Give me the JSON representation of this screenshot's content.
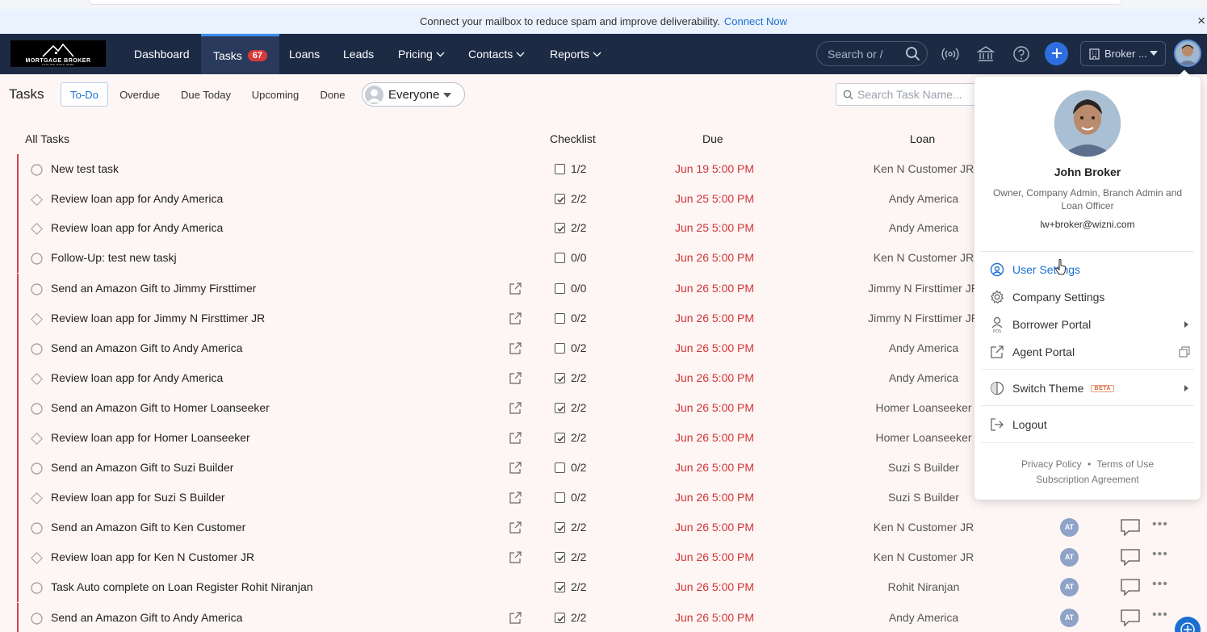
{
  "banner": {
    "message": "Connect your mailbox to reduce spam and improve deliverability.",
    "link": "Connect Now",
    "close": "×"
  },
  "logo": {
    "text": "MORTGAGE BROKER",
    "tagline": "TAGLINE GOES HERE"
  },
  "nav": {
    "items": [
      {
        "label": "Dashboard"
      },
      {
        "label": "Tasks",
        "badge": "67"
      },
      {
        "label": "Loans"
      },
      {
        "label": "Leads"
      },
      {
        "label": "Pricing"
      },
      {
        "label": "Contacts"
      },
      {
        "label": "Reports"
      }
    ],
    "search_placeholder": "Search or /",
    "broker_label": "Broker ..."
  },
  "toolbar": {
    "title": "Tasks",
    "tabs": [
      "To-Do",
      "Overdue",
      "Due Today",
      "Upcoming",
      "Done"
    ],
    "active_tab": "To-Do",
    "assignee": "Everyone",
    "search_placeholder": "Search Task Name..."
  },
  "columns": {
    "name": "All Tasks",
    "checklist": "Checklist",
    "due": "Due",
    "loan": "Loan"
  },
  "tasks": [
    {
      "name": "New test task",
      "shape": "circle",
      "ext": false,
      "checked": false,
      "count": "1/2",
      "due": "Jun 19 5:00 PM",
      "loan": "Ken N Customer JR",
      "assignee": ""
    },
    {
      "name": "Review loan app for Andy America",
      "shape": "diamond",
      "ext": false,
      "checked": true,
      "count": "2/2",
      "due": "Jun 25 5:00 PM",
      "loan": "Andy America",
      "assignee": ""
    },
    {
      "name": "Review loan app for Andy America",
      "shape": "diamond",
      "ext": false,
      "checked": true,
      "count": "2/2",
      "due": "Jun 25 5:00 PM",
      "loan": "Andy America",
      "assignee": ""
    },
    {
      "name": "Follow-Up: test new taskj",
      "shape": "circle",
      "ext": false,
      "checked": false,
      "count": "0/0",
      "due": "Jun 26 5:00 PM",
      "loan": "Ken N Customer JR",
      "assignee": ""
    },
    {
      "name": "Send an Amazon Gift to Jimmy Firsttimer",
      "shape": "circle",
      "ext": true,
      "checked": false,
      "count": "0/0",
      "due": "Jun 26 5:00 PM",
      "loan": "Jimmy N Firsttimer JR",
      "assignee": ""
    },
    {
      "name": "Review loan app for Jimmy N Firsttimer JR",
      "shape": "diamond",
      "ext": true,
      "checked": false,
      "count": "0/2",
      "due": "Jun 26 5:00 PM",
      "loan": "Jimmy N Firsttimer JR",
      "assignee": ""
    },
    {
      "name": "Send an Amazon Gift to Andy America",
      "shape": "circle",
      "ext": true,
      "checked": false,
      "count": "0/2",
      "due": "Jun 26 5:00 PM",
      "loan": "Andy America",
      "assignee": ""
    },
    {
      "name": "Review loan app for Andy America",
      "shape": "diamond",
      "ext": true,
      "checked": true,
      "count": "2/2",
      "due": "Jun 26 5:00 PM",
      "loan": "Andy America",
      "assignee": ""
    },
    {
      "name": "Send an Amazon Gift to Homer Loanseeker",
      "shape": "circle",
      "ext": true,
      "checked": true,
      "count": "2/2",
      "due": "Jun 26 5:00 PM",
      "loan": "Homer Loanseeker",
      "assignee": ""
    },
    {
      "name": "Review loan app for Homer Loanseeker",
      "shape": "diamond",
      "ext": true,
      "checked": true,
      "count": "2/2",
      "due": "Jun 26 5:00 PM",
      "loan": "Homer Loanseeker",
      "assignee": ""
    },
    {
      "name": "Send an Amazon Gift to Suzi Builder",
      "shape": "circle",
      "ext": true,
      "checked": false,
      "count": "0/2",
      "due": "Jun 26 5:00 PM",
      "loan": "Suzi S Builder",
      "assignee": ""
    },
    {
      "name": "Review loan app for Suzi S Builder",
      "shape": "diamond",
      "ext": true,
      "checked": false,
      "count": "0/2",
      "due": "Jun 26 5:00 PM",
      "loan": "Suzi S Builder",
      "assignee": ""
    },
    {
      "name": "Send an Amazon Gift to Ken Customer",
      "shape": "circle",
      "ext": true,
      "checked": true,
      "count": "2/2",
      "due": "Jun 26 5:00 PM",
      "loan": "Ken N Customer JR",
      "assignee": "AT"
    },
    {
      "name": "Review loan app for Ken N Customer JR",
      "shape": "diamond",
      "ext": true,
      "checked": true,
      "count": "2/2",
      "due": "Jun 26 5:00 PM",
      "loan": "Ken N Customer JR",
      "assignee": "AT"
    },
    {
      "name": "Task Auto complete on Loan Register Rohit Niranjan",
      "shape": "circle",
      "ext": false,
      "checked": true,
      "count": "2/2",
      "due": "Jun 26 5:00 PM",
      "loan": "Rohit Niranjan",
      "assignee": "AT"
    },
    {
      "name": "Send an Amazon Gift to Andy America",
      "shape": "circle",
      "ext": true,
      "checked": true,
      "count": "2/2",
      "due": "Jun 26 5:00 PM",
      "loan": "Andy America",
      "assignee": "AT"
    }
  ],
  "user_menu": {
    "name": "John Broker",
    "roles": "Owner, Company Admin, Branch Admin and Loan Officer",
    "email": "lw+broker@wizni.com",
    "items": [
      {
        "label": "User Settings",
        "icon": "user-gear-icon"
      },
      {
        "label": "Company Settings",
        "icon": "gear-icon"
      },
      {
        "label": "Borrower Portal",
        "icon": "pos-user-icon"
      },
      {
        "label": "Agent Portal",
        "icon": "external-link-icon"
      },
      {
        "label": "Switch Theme",
        "icon": "theme-icon",
        "badge": "BETA"
      },
      {
        "label": "Logout",
        "icon": "logout-icon"
      }
    ],
    "footer": {
      "privacy": "Privacy Policy",
      "sep": "•",
      "terms": "Terms of Use",
      "subscription": "Subscription Agreement"
    }
  },
  "colors": {
    "nav_bg": "#1d2a44",
    "accent": "#1b6fd1",
    "due_red": "#d23535",
    "row_border": "#d4424a",
    "badge_red": "#d93838"
  }
}
